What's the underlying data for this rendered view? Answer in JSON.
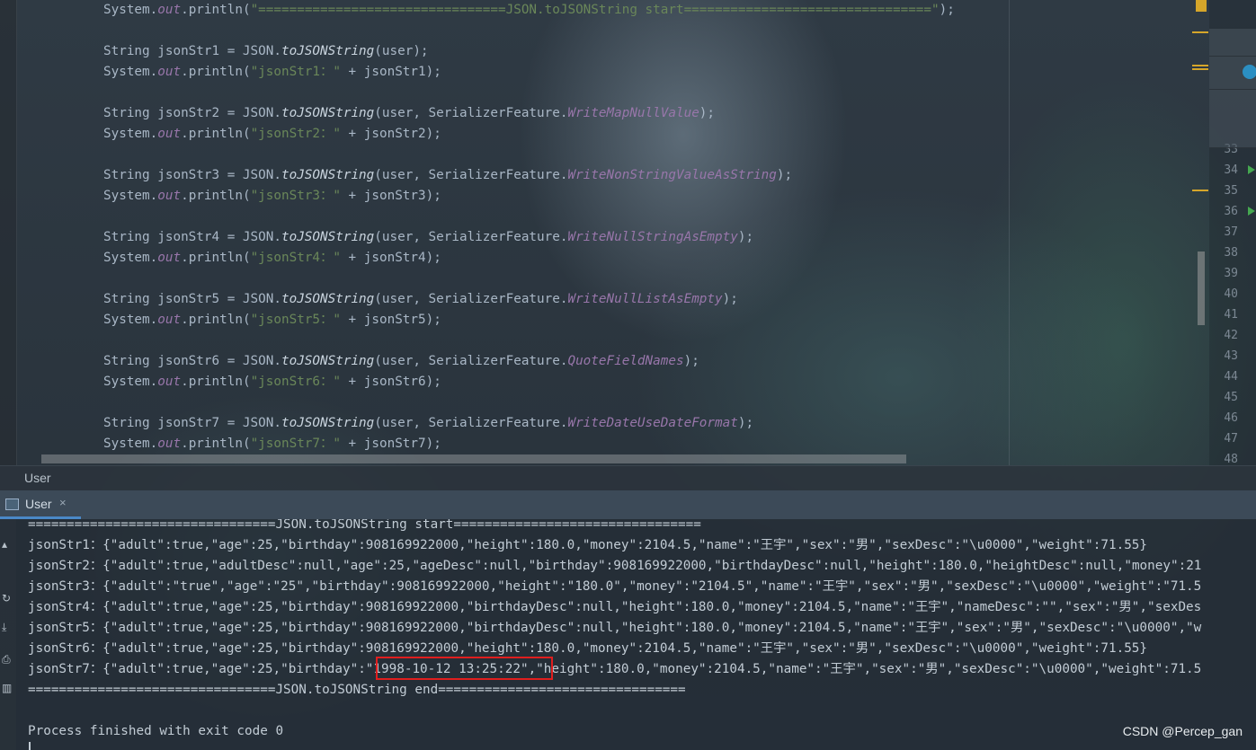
{
  "editor": {
    "code_lines": [
      {
        "segments": [
          {
            "t": "System.",
            "c": "kw"
          },
          {
            "t": "out",
            "c": "fld"
          },
          {
            "t": ".println(",
            "c": "kw"
          },
          {
            "t": "\"================================JSON.toJSONString start================================\"",
            "c": "str"
          },
          {
            "t": ");",
            "c": "kw"
          }
        ]
      },
      {
        "segments": []
      },
      {
        "segments": [
          {
            "t": "String jsonStr1 = JSON.",
            "c": "kw"
          },
          {
            "t": "toJSONString",
            "c": "it"
          },
          {
            "t": "(user);",
            "c": "kw"
          }
        ]
      },
      {
        "segments": [
          {
            "t": "System.",
            "c": "kw"
          },
          {
            "t": "out",
            "c": "fld"
          },
          {
            "t": ".println(",
            "c": "kw"
          },
          {
            "t": "\"jsonStr1：\"",
            "c": "str"
          },
          {
            "t": " + jsonStr1);",
            "c": "kw"
          }
        ]
      },
      {
        "segments": []
      },
      {
        "segments": [
          {
            "t": "String jsonStr2 = JSON.",
            "c": "kw"
          },
          {
            "t": "toJSONString",
            "c": "it"
          },
          {
            "t": "(user, SerializerFeature.",
            "c": "kw"
          },
          {
            "t": "WriteMapNullValue",
            "c": "fld"
          },
          {
            "t": ");",
            "c": "kw"
          }
        ]
      },
      {
        "segments": [
          {
            "t": "System.",
            "c": "kw"
          },
          {
            "t": "out",
            "c": "fld"
          },
          {
            "t": ".println(",
            "c": "kw"
          },
          {
            "t": "\"jsonStr2：\"",
            "c": "str"
          },
          {
            "t": " + jsonStr2);",
            "c": "kw"
          }
        ]
      },
      {
        "segments": []
      },
      {
        "segments": [
          {
            "t": "String jsonStr3 = JSON.",
            "c": "kw"
          },
          {
            "t": "toJSONString",
            "c": "it"
          },
          {
            "t": "(user, SerializerFeature.",
            "c": "kw"
          },
          {
            "t": "WriteNonStringValueAsString",
            "c": "fld"
          },
          {
            "t": ");",
            "c": "kw"
          }
        ]
      },
      {
        "segments": [
          {
            "t": "System.",
            "c": "kw"
          },
          {
            "t": "out",
            "c": "fld"
          },
          {
            "t": ".println(",
            "c": "kw"
          },
          {
            "t": "\"jsonStr3：\"",
            "c": "str"
          },
          {
            "t": " + jsonStr3);",
            "c": "kw"
          }
        ]
      },
      {
        "segments": []
      },
      {
        "segments": [
          {
            "t": "String jsonStr4 = JSON.",
            "c": "kw"
          },
          {
            "t": "toJSONString",
            "c": "it"
          },
          {
            "t": "(user, SerializerFeature.",
            "c": "kw"
          },
          {
            "t": "WriteNullStringAsEmpty",
            "c": "fld"
          },
          {
            "t": ");",
            "c": "kw"
          }
        ]
      },
      {
        "segments": [
          {
            "t": "System.",
            "c": "kw"
          },
          {
            "t": "out",
            "c": "fld"
          },
          {
            "t": ".println(",
            "c": "kw"
          },
          {
            "t": "\"jsonStr4：\"",
            "c": "str"
          },
          {
            "t": " + jsonStr4);",
            "c": "kw"
          }
        ]
      },
      {
        "segments": []
      },
      {
        "segments": [
          {
            "t": "String jsonStr5 = JSON.",
            "c": "kw"
          },
          {
            "t": "toJSONString",
            "c": "it"
          },
          {
            "t": "(user, SerializerFeature.",
            "c": "kw"
          },
          {
            "t": "WriteNullListAsEmpty",
            "c": "fld"
          },
          {
            "t": ");",
            "c": "kw"
          }
        ]
      },
      {
        "segments": [
          {
            "t": "System.",
            "c": "kw"
          },
          {
            "t": "out",
            "c": "fld"
          },
          {
            "t": ".println(",
            "c": "kw"
          },
          {
            "t": "\"jsonStr5：\"",
            "c": "str"
          },
          {
            "t": " + jsonStr5);",
            "c": "kw"
          }
        ]
      },
      {
        "segments": []
      },
      {
        "segments": [
          {
            "t": "String jsonStr6 = JSON.",
            "c": "kw"
          },
          {
            "t": "toJSONString",
            "c": "it"
          },
          {
            "t": "(user, SerializerFeature.",
            "c": "kw"
          },
          {
            "t": "QuoteFieldNames",
            "c": "fld"
          },
          {
            "t": ");",
            "c": "kw"
          }
        ]
      },
      {
        "segments": [
          {
            "t": "System.",
            "c": "kw"
          },
          {
            "t": "out",
            "c": "fld"
          },
          {
            "t": ".println(",
            "c": "kw"
          },
          {
            "t": "\"jsonStr6：\"",
            "c": "str"
          },
          {
            "t": " + jsonStr6);",
            "c": "kw"
          }
        ]
      },
      {
        "segments": []
      },
      {
        "segments": [
          {
            "t": "String jsonStr7 = JSON.",
            "c": "kw"
          },
          {
            "t": "toJSONString",
            "c": "it"
          },
          {
            "t": "(user, SerializerFeature.",
            "c": "kw"
          },
          {
            "t": "WriteDateUseDateFormat",
            "c": "fld"
          },
          {
            "t": ");",
            "c": "kw"
          }
        ]
      },
      {
        "segments": [
          {
            "t": "System.",
            "c": "kw"
          },
          {
            "t": "out",
            "c": "fld"
          },
          {
            "t": ".println(",
            "c": "kw"
          },
          {
            "t": "\"jsonStr7：\"",
            "c": "str"
          },
          {
            "t": " + jsonStr7);",
            "c": "kw"
          }
        ]
      }
    ],
    "line_numbers": [
      "33",
      "34",
      "35",
      "36",
      "37",
      "38",
      "39",
      "40",
      "41",
      "42",
      "43",
      "44",
      "45",
      "46",
      "47",
      "48"
    ],
    "run_marker_lines": [
      "34",
      "36"
    ]
  },
  "breadcrumb": {
    "label": "User"
  },
  "run_tab": {
    "label": "User",
    "close": "×",
    "icon": "run-window-icon"
  },
  "console": {
    "lines": [
      "================================JSON.toJSONString start================================",
      "jsonStr1：{\"adult\":true,\"age\":25,\"birthday\":908169922000,\"height\":180.0,\"money\":2104.5,\"name\":\"王宇\",\"sex\":\"男\",\"sexDesc\":\"\\u0000\",\"weight\":71.55}",
      "jsonStr2：{\"adult\":true,\"adultDesc\":null,\"age\":25,\"ageDesc\":null,\"birthday\":908169922000,\"birthdayDesc\":null,\"height\":180.0,\"heightDesc\":null,\"money\":21",
      "jsonStr3：{\"adult\":\"true\",\"age\":\"25\",\"birthday\":908169922000,\"height\":\"180.0\",\"money\":\"2104.5\",\"name\":\"王宇\",\"sex\":\"男\",\"sexDesc\":\"\\u0000\",\"weight\":\"71.5",
      "jsonStr4：{\"adult\":true,\"age\":25,\"birthday\":908169922000,\"birthdayDesc\":null,\"height\":180.0,\"money\":2104.5,\"name\":\"王宇\",\"nameDesc\":\"\",\"sex\":\"男\",\"sexDes",
      "jsonStr5：{\"adult\":true,\"age\":25,\"birthday\":908169922000,\"birthdayDesc\":null,\"height\":180.0,\"money\":2104.5,\"name\":\"王宇\",\"sex\":\"男\",\"sexDesc\":\"\\u0000\",\"w",
      "jsonStr6：{\"adult\":true,\"age\":25,\"birthday\":908169922000,\"height\":180.0,\"money\":2104.5,\"name\":\"王宇\",\"sex\":\"男\",\"sexDesc\":\"\\u0000\",\"weight\":71.55}",
      "jsonStr7：{\"adult\":true,\"age\":25,\"birthday\":\"1998-10-12 13:25:22\",\"height\":180.0,\"money\":2104.5,\"name\":\"王宇\",\"sex\":\"男\",\"sexDesc\":\"\\u0000\",\"weight\":71.5",
      "================================JSON.toJSONString end================================",
      "",
      "Process finished with exit code 0"
    ],
    "highlighted_value": "\"1998-10-12 13:25:22\""
  },
  "console_tools": [
    "rerun-icon",
    "scroll-to-end-icon",
    "print-icon",
    "clear-icon"
  ],
  "watermark": "CSDN @Percep_gan",
  "colors": {
    "highlight_border": "#e01e1e",
    "string": "#6a8759",
    "field": "#9876aa",
    "text": "#a9b7c6"
  }
}
